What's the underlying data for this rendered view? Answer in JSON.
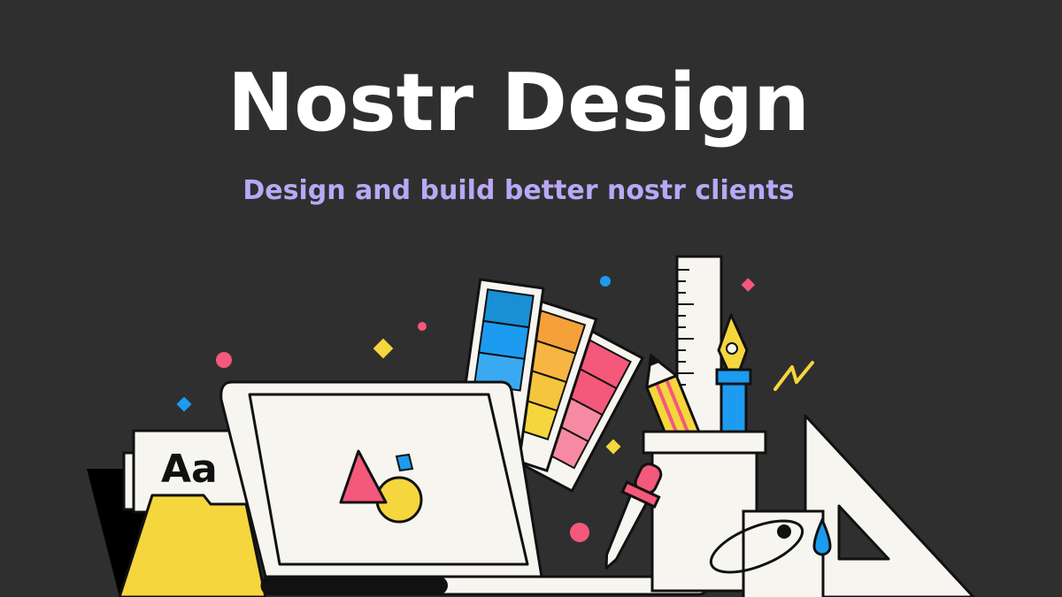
{
  "header": {
    "title": "Nostr Design",
    "subtitle": "Design and build better nostr clients"
  },
  "illustration": {
    "type_specimen_label": "Aa",
    "colors": {
      "background": "#2f2f2f",
      "title": "#ffffff",
      "subtitle": "#b9a8f5",
      "paper": "#f7f5f0",
      "outline": "#111111",
      "pink": "#f4587a",
      "yellow": "#f5d63d",
      "blue": "#1d9bf0",
      "orange": "#f5a13a",
      "lilac": "#b9a8f5"
    },
    "icons": [
      "laptop-icon",
      "color-swatch-icon",
      "ruler-icon",
      "fountain-pen-icon",
      "pencil-icon",
      "pen-holder-icon",
      "set-square-icon",
      "paint-bucket-icon",
      "eyedropper-icon",
      "folder-icon",
      "typography-card-icon",
      "lightning-bolt-icon",
      "shapes-icon"
    ]
  }
}
